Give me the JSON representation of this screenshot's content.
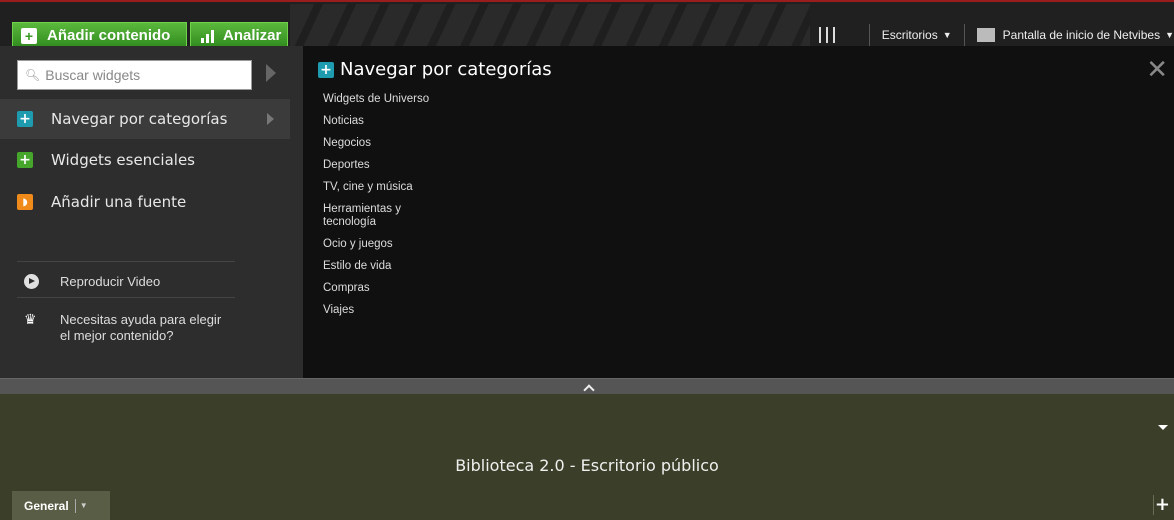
{
  "toolbar": {
    "add_content": "Añadir contenido",
    "analyze": "Analizar",
    "desktops": "Escritorios",
    "netvibes_home": "Pantalla de inicio de Netvibes"
  },
  "left": {
    "search_placeholder": "Buscar widgets",
    "menu": [
      {
        "label": "Navegar por categorías"
      },
      {
        "label": "Widgets esenciales"
      },
      {
        "label": "Añadir una fuente"
      }
    ],
    "play_video": "Reproducir Video",
    "help_text": "Necesitas ayuda para elegir el mejor contenido?"
  },
  "main": {
    "title": "Navegar por categorías",
    "categories": [
      "Widgets de Universo",
      "Noticias",
      "Negocios",
      "Deportes",
      "TV, cine y música",
      "Herramientas y tecnología",
      "Ocio y juegos",
      "Estilo de vida",
      "Compras",
      "Viajes"
    ]
  },
  "dashboard": {
    "title": "Biblioteca 2.0 - Escritorio público",
    "tab": "General"
  },
  "colors": {
    "accent_green": "#46a52b",
    "dashboard_bg": "#3b3e28",
    "panel_bg": "#2d2d2d"
  }
}
